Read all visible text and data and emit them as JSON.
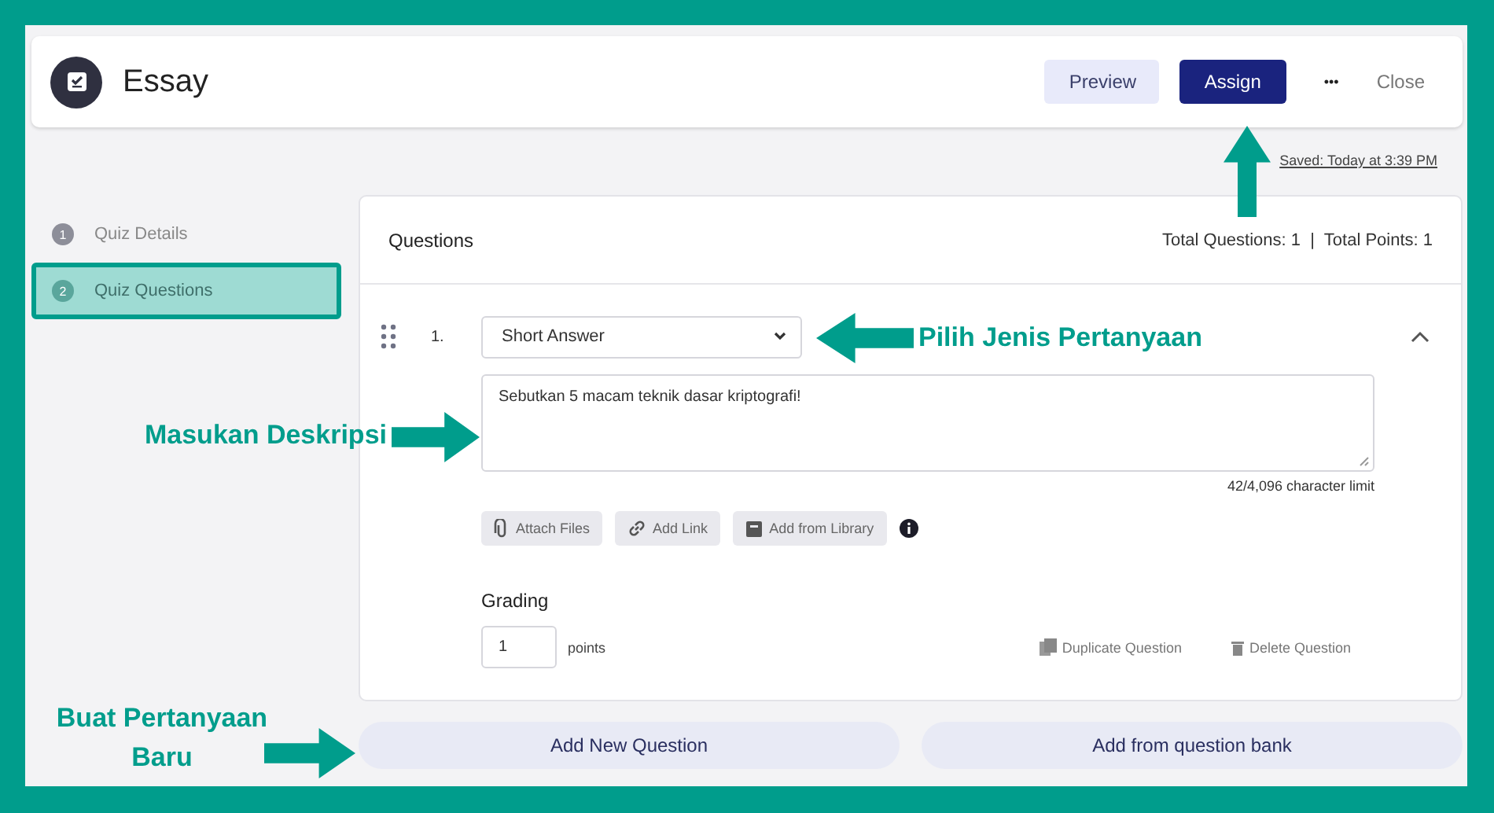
{
  "header": {
    "title": "Essay",
    "buttons": [
      {
        "label": "Preview",
        "kind": "secondary"
      },
      {
        "label": "Assign",
        "kind": "primary"
      }
    ],
    "more": "•••",
    "close": "Close"
  },
  "saved": "Saved: Today at 3:39 PM",
  "sidebar": {
    "items": [
      {
        "number": "1",
        "label": "Quiz Details",
        "selected": false
      },
      {
        "number": "2",
        "label": "Quiz Questions",
        "selected": true
      }
    ]
  },
  "questions": {
    "title": "Questions",
    "totals": "Total Questions: 1  |  Total Points: 1",
    "items": [
      {
        "number": "1.",
        "type": "Short Answer",
        "expanded": true,
        "description": "Sebutkan 5 macam teknik dasar kriptografi!",
        "char_limit": "42/4,096 character limit",
        "attachments": [
          {
            "label": "Attach Files",
            "kind": "clip"
          },
          {
            "label": "Add Link",
            "kind": "link"
          },
          {
            "label": "Add from Library",
            "kind": "library"
          }
        ],
        "grading_label": "Grading",
        "points": "1",
        "points_unit": "points",
        "actions": [
          {
            "label": "Duplicate Question",
            "kind": "duplicate"
          },
          {
            "label": "Delete Question",
            "kind": "delete"
          }
        ]
      }
    ]
  },
  "footer_buttons": [
    "Add New Question",
    "Add from question bank"
  ],
  "annotations": [
    {
      "kind": "up"
    },
    {
      "kind": "left",
      "label": "Pilih Jenis Pertanyaan"
    },
    {
      "kind": "right",
      "label": "Masukan Deskripsi"
    },
    {
      "kind": "right",
      "label": "Buat Pertanyaan Baru"
    }
  ]
}
